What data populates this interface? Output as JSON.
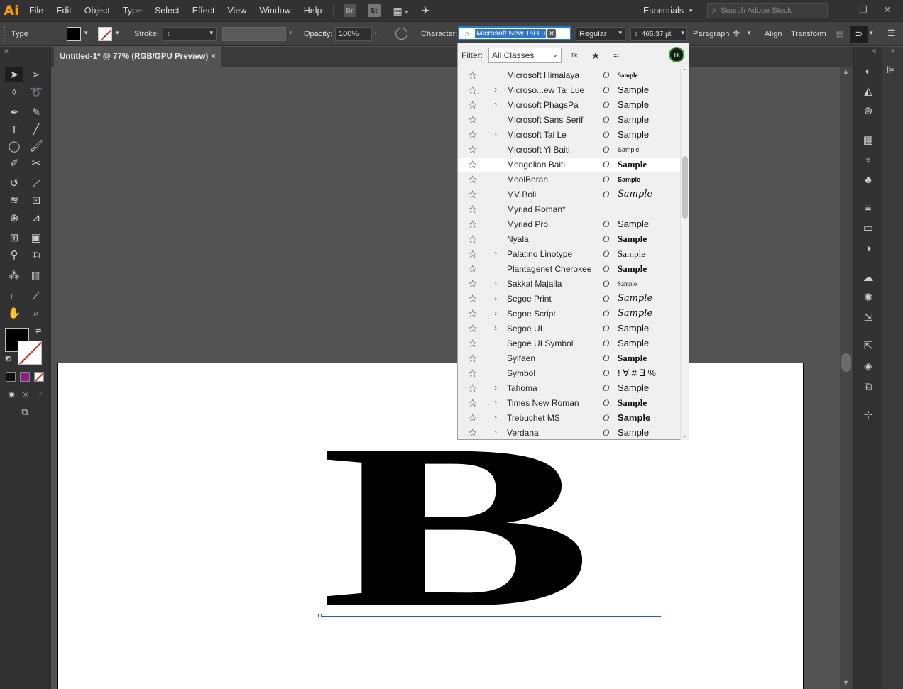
{
  "app": {
    "logo": "Ai",
    "menus": [
      "File",
      "Edit",
      "Object",
      "Type",
      "Select",
      "Effect",
      "View",
      "Window",
      "Help"
    ],
    "bridge_badge": "Br",
    "stock_badge": "St",
    "workspace": "Essentials",
    "stock_search_placeholder": "Search Adobe Stock"
  },
  "control_bar": {
    "mode": "Type",
    "stroke_label": "Stroke:",
    "opacity_label": "Opacity:",
    "opacity_value": "100%",
    "character_label": "Character:",
    "font_search_value": "Microsoft New Tai Lue",
    "font_style": "Regular",
    "font_size": "465.37 pt",
    "paragraph_label": "Paragraph",
    "align_label": "Align",
    "transform_label": "Transform"
  },
  "document": {
    "tab_title": "Untitled-1* @ 77% (RGB/GPU Preview)",
    "artboard_text": "B"
  },
  "font_panel": {
    "filter_label": "Filter:",
    "filter_value": "All Classes",
    "typekit_badge": "Tk",
    "fonts": [
      {
        "name": "Microsoft Himalaya",
        "family": false,
        "sample": "Sample",
        "style": "small serif bold"
      },
      {
        "name": "Microso...ew Tai Lue",
        "family": true,
        "sample": "Sample",
        "style": ""
      },
      {
        "name": "Microsoft PhagsPa",
        "family": true,
        "sample": "Sample",
        "style": ""
      },
      {
        "name": "Microsoft Sans Serif",
        "family": false,
        "sample": "Sample",
        "style": ""
      },
      {
        "name": "Microsoft Tai Le",
        "family": true,
        "sample": "Sample",
        "style": ""
      },
      {
        "name": "Microsoft Yi Baiti",
        "family": false,
        "sample": "Sample",
        "style": "small"
      },
      {
        "name": "Mongolian Baiti",
        "family": false,
        "sample": "Sample",
        "style": "serif bold"
      },
      {
        "name": "MoolBoran",
        "family": false,
        "sample": "Sample",
        "style": "small bold"
      },
      {
        "name": "MV Boli",
        "family": false,
        "sample": "Sample",
        "style": "script"
      },
      {
        "name": "Myriad Roman*",
        "family": false,
        "sample": "",
        "style": ""
      },
      {
        "name": "Myriad Pro",
        "family": false,
        "sample": "Sample",
        "style": ""
      },
      {
        "name": "Nyala",
        "family": false,
        "sample": "Sample",
        "style": "serif bold"
      },
      {
        "name": "Palatino Linotype",
        "family": true,
        "sample": "Sample",
        "style": "serif"
      },
      {
        "name": "Plantagenet Cherokee",
        "family": false,
        "sample": "Sample",
        "style": "serif bold"
      },
      {
        "name": "Sakkal Majalla",
        "family": true,
        "sample": "Sample",
        "style": "small serif"
      },
      {
        "name": "Segoe Print",
        "family": true,
        "sample": "Sample",
        "style": "script"
      },
      {
        "name": "Segoe Script",
        "family": true,
        "sample": "Sample",
        "style": "script"
      },
      {
        "name": "Segoe UI",
        "family": true,
        "sample": "Sample",
        "style": ""
      },
      {
        "name": "Segoe UI Symbol",
        "family": false,
        "sample": "Sample",
        "style": ""
      },
      {
        "name": "Sylfaen",
        "family": false,
        "sample": "Sample",
        "style": "serif bold"
      },
      {
        "name": "Symbol",
        "family": false,
        "sample": "! ∀ # ∃ %",
        "style": ""
      },
      {
        "name": "Tahoma",
        "family": true,
        "sample": "Sample",
        "style": ""
      },
      {
        "name": "Times New Roman",
        "family": true,
        "sample": "Sample",
        "style": "serif bold"
      },
      {
        "name": "Trebuchet MS",
        "family": true,
        "sample": "Sample",
        "style": "bold"
      },
      {
        "name": "Verdana",
        "family": true,
        "sample": "Sample",
        "style": ""
      }
    ],
    "otype_glyph": "O",
    "highlighted_index": 6
  },
  "icons": {
    "star": "☆",
    "star_filled": "★",
    "similar": "≈",
    "chevron": "›",
    "dropdown": "⌄",
    "close": "✕"
  },
  "colors": {
    "accent": "#1b7bd6",
    "logo": "#ff9a00",
    "selection": "#3176c8",
    "baseline": "#1f5fc4"
  }
}
